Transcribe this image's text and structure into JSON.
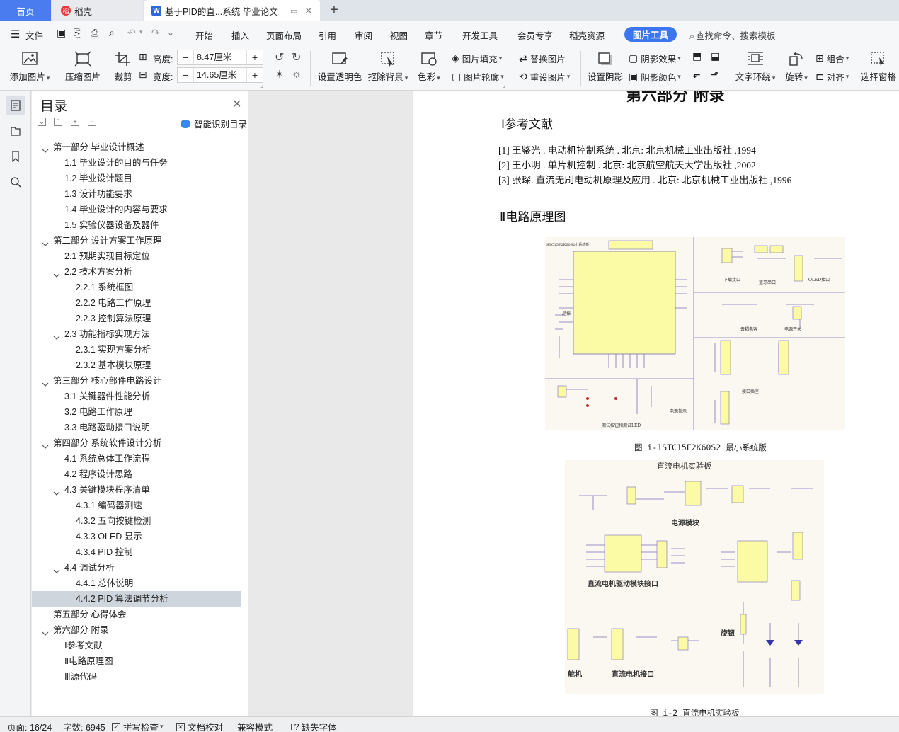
{
  "tabs": {
    "home": "首页",
    "docer": "稻壳",
    "document": "基于PID的直...系统 毕业论文"
  },
  "menu": {
    "file": "文件",
    "items": [
      "开始",
      "插入",
      "页面布局",
      "引用",
      "审阅",
      "视图",
      "章节",
      "开发工具",
      "会员专享",
      "稻壳资源"
    ],
    "active_tool": "图片工具",
    "search": "查找命令、搜索模板"
  },
  "ribbon": {
    "add_picture": "添加图片",
    "compress": "压缩图片",
    "crop": "裁剪",
    "height_label": "高度:",
    "height_value": "8.47厘米",
    "width_label": "宽度:",
    "width_value": "14.65厘米",
    "transparent": "设置透明色",
    "remove_bg": "抠除背景",
    "color": "色彩",
    "pic_fill": "图片填充",
    "pic_outline": "图片轮廓",
    "replace": "替换图片",
    "reset": "重设图片",
    "shadow": "设置阴影",
    "shadow_effect": "阴影效果",
    "shadow_color": "阴影颜色",
    "text_wrap": "文字环绕",
    "rotate": "旋转",
    "group": "组合",
    "align": "对齐",
    "select_pane": "选择窗格"
  },
  "toc": {
    "title": "目录",
    "smart": "智能识别目录",
    "items": [
      {
        "label": "第一部分  毕业设计概述",
        "level": 1,
        "toggle": true
      },
      {
        "label": "1.1  毕业设计的目的与任务",
        "level": 2
      },
      {
        "label": "1.2  毕业设计题目",
        "level": 2
      },
      {
        "label": "1.3  设计功能要求",
        "level": 2
      },
      {
        "label": "1.4  毕业设计的内容与要求",
        "level": 2
      },
      {
        "label": "1.5  实验仪器设备及器件",
        "level": 2
      },
      {
        "label": "第二部分  设计方案工作原理",
        "level": 1,
        "toggle": true
      },
      {
        "label": "2.1  预期实现目标定位",
        "level": 2
      },
      {
        "label": "2.2  技术方案分析",
        "level": 2,
        "toggle": true
      },
      {
        "label": "2.2.1 系统框图",
        "level": 3
      },
      {
        "label": "2.2.2 电路工作原理",
        "level": 3
      },
      {
        "label": "2.2.3 控制算法原理",
        "level": 3
      },
      {
        "label": "2.3  功能指标实现方法",
        "level": 2,
        "toggle": true
      },
      {
        "label": "2.3.1  实现方案分析",
        "level": 3
      },
      {
        "label": "2.3.2  基本模块原理",
        "level": 3
      },
      {
        "label": "第三部分  核心部件电路设计",
        "level": 1,
        "toggle": true
      },
      {
        "label": "3.1  关键器件性能分析",
        "level": 2
      },
      {
        "label": "3.2  电路工作原理",
        "level": 2
      },
      {
        "label": "3.3  电路驱动接口说明",
        "level": 2
      },
      {
        "label": "第四部分  系统软件设计分析",
        "level": 1,
        "toggle": true
      },
      {
        "label": "4.1  系统总体工作流程",
        "level": 2
      },
      {
        "label": "4.2  程序设计思路",
        "level": 2
      },
      {
        "label": "4.3  关键模块程序清单",
        "level": 2,
        "toggle": true
      },
      {
        "label": "4.3.1 编码器测速",
        "level": 3
      },
      {
        "label": "4.3.2 五向按键检测",
        "level": 3
      },
      {
        "label": "4.3.3 OLED 显示",
        "level": 3
      },
      {
        "label": "4.3.4 PID 控制",
        "level": 3
      },
      {
        "label": "4.4  调试分析",
        "level": 2,
        "toggle": true
      },
      {
        "label": "4.4.1  总体说明",
        "level": 3
      },
      {
        "label": "4.4.2 PID 算法调节分析",
        "level": 3,
        "selected": true
      },
      {
        "label": "第五部分  心得体会",
        "level": 1
      },
      {
        "label": "第六部分  附录",
        "level": 1,
        "toggle": true
      },
      {
        "label": "Ⅰ参考文献",
        "level": 2
      },
      {
        "label": "Ⅱ电路原理图",
        "level": 2
      },
      {
        "label": "Ⅲ源代码",
        "level": 2
      }
    ]
  },
  "doc": {
    "heading_top": "第六部分  附录",
    "section1": "Ⅰ参考文献",
    "refs": [
      "[1] 王鉴光 . 电动机控制系统 . 北京: 北京机械工业出版社 ,1994",
      "[2] 王小明 . 单片机控制 . 北京: 北京航空航天大学出版社 ,2002",
      "[3] 张琛. 直流无刷电动机原理及应用 . 北京: 北京机械工业出版社 ,1996"
    ],
    "section2": "Ⅱ电路原理图",
    "fig1_caption": "图 i-1STC15F2K60S2 最小系统版",
    "fig2_caption": "图 i-2  直流电机实验板",
    "fig1_labels": {
      "board": "STC15F2K60S2小系统板",
      "crystal": "晶振",
      "download": "下载接口",
      "bluetooth": "蓝牙串口",
      "oled": "OLED接口",
      "decoupling": "去耦电容",
      "power_switch": "电源开关",
      "test_led": "测试按钮和测试LED",
      "power_indicator": "电源指示",
      "expansion": "接口插座"
    },
    "fig2_labels": {
      "title": "直流电机实验板",
      "power_module": "电源模块",
      "driver_interface": "直流电机驱动模块接口",
      "servo": "舵机",
      "motor_interface": "直流电机接口",
      "knob": "旋钮"
    }
  },
  "status": {
    "page": "页面: 16/24",
    "words": "字数: 6945",
    "spell": "拼写检查",
    "proof": "文档校对",
    "compat": "兼容模式",
    "missing_font": "缺失字体"
  },
  "colors": {
    "accent": "#3b76f0",
    "home_tab": "#4a7cf0",
    "mcu_yellow": "#fafba4",
    "schematic_line": "#7b6fb8"
  }
}
